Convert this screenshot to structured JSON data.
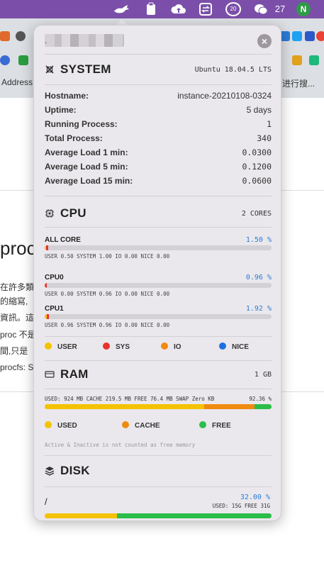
{
  "menubar": {
    "notifications_count": "27",
    "badge_value": "20",
    "n_icon_label": "N"
  },
  "background": {
    "address_fragment": "Address",
    "search_fragment": "进行搜...",
    "heading_fragment": "proc",
    "text_lines": [
      "在許多類",
      "的縮寫,",
      "資訊。這",
      "proc 不是",
      "間,只是",
      "procfs: S"
    ]
  },
  "panel": {
    "title_prefix": ".",
    "close_label": "×",
    "system": {
      "title": "SYSTEM",
      "os": "Ubuntu 18.04.5 LTS",
      "rows": [
        {
          "label": "Hostname:",
          "value": "instance-20210108-0324"
        },
        {
          "label": "Uptime:",
          "value": "5 days"
        },
        {
          "label": "Running Process:",
          "value": "1"
        },
        {
          "label": "Total Process:",
          "value": "340"
        },
        {
          "label": "Average Load 1 min:",
          "value": "0.0300"
        },
        {
          "label": "Average Load 5 min:",
          "value": "0.1200"
        },
        {
          "label": "Average Load 15 min:",
          "value": "0.0600"
        }
      ]
    },
    "cpu": {
      "title": "CPU",
      "cores": "2 CORES",
      "items": [
        {
          "name": "ALL CORE",
          "pct": "1.50 %",
          "detail": "USER 0.50 SYSTEM 1.00 IO 0.00 NICE 0.00",
          "user": 0.5,
          "sys": 1.0,
          "io": 0.0,
          "nice": 0.0
        },
        {
          "name": "CPU0",
          "pct": "0.96 %",
          "detail": "USER 0.00 SYSTEM 0.96 IO 0.00 NICE 0.00",
          "user": 0.0,
          "sys": 0.96,
          "io": 0.0,
          "nice": 0.0
        },
        {
          "name": "CPU1",
          "pct": "1.92 %",
          "detail": "USER 0.96 SYSTEM 0.96 IO 0.00 NICE 0.00",
          "user": 0.96,
          "sys": 0.96,
          "io": 0.0,
          "nice": 0.0
        }
      ],
      "legend": [
        "USER",
        "SYS",
        "IO",
        "NICE"
      ]
    },
    "ram": {
      "title": "RAM",
      "total": "1 GB",
      "summary": "USED: 924 MB CACHE 219.5 MB FREE 76.4 MB SWAP Zero KB",
      "pct": "92.36 %",
      "used_pct": 70.3,
      "cache_pct": 22.1,
      "free_pct": 7.6,
      "legend": [
        "USED",
        "CACHE",
        "FREE"
      ],
      "note": "Active & Inactive is not counted as free memory"
    },
    "disk": {
      "title": "DISK",
      "mount": "/",
      "pct": "32.00 %",
      "info": "USED: 15G FREE 31G",
      "used_pct": 32.0
    }
  },
  "colors": {
    "user": "#f5c200",
    "sys": "#e8332f",
    "io": "#f08a10",
    "nice": "#1f6fe0",
    "free": "#2bbd4a",
    "accent_blue": "#2a7bd8"
  }
}
